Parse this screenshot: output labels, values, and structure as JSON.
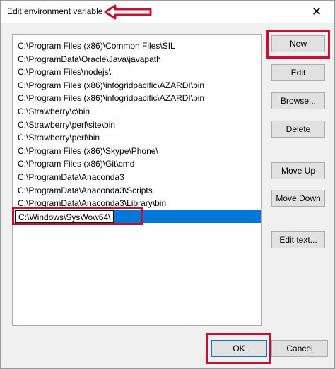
{
  "window": {
    "title": "Edit environment variable",
    "close_glyph": "✕"
  },
  "paths": [
    "C:\\Program Files (x86)\\Common Files\\SIL",
    "C:\\ProgramData\\Oracle\\Java\\javapath",
    "C:\\Program Files\\nodejs\\",
    "C:\\Program Files (x86)\\infogridpacific\\AZARDI\\bin",
    "C:\\Program Files (x86)\\infogridpacific\\AZARDI\\bin",
    "C:\\Strawberry\\c\\bin",
    "C:\\Strawberry\\perl\\site\\bin",
    "C:\\Strawberry\\perl\\bin",
    "C:\\Program Files (x86)\\Skype\\Phone\\",
    "C:\\Program Files (x86)\\Git\\cmd",
    "C:\\ProgramData\\Anaconda3",
    "C:\\ProgramData\\Anaconda3\\Scripts",
    "C:\\ProgramData\\Anaconda3\\Library\\bin"
  ],
  "editing_row": {
    "value": "C:\\Windows\\SysWow64\\"
  },
  "buttons": {
    "new": "New",
    "edit": "Edit",
    "browse": "Browse...",
    "delete": "Delete",
    "move_up": "Move Up",
    "move_down": "Move Down",
    "edit_text": "Edit text...",
    "ok": "OK",
    "cancel": "Cancel"
  },
  "colors": {
    "selection": "#0078d7",
    "annotation": "#c8102e"
  }
}
